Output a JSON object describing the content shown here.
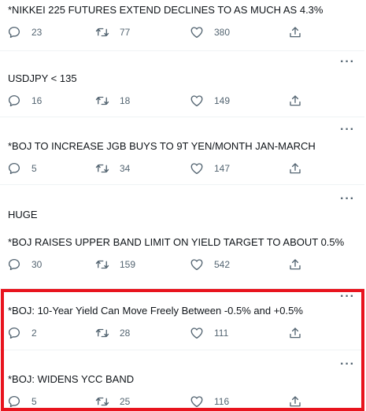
{
  "tweets": [
    {
      "text": "*NIKKEI 225 FUTURES EXTEND DECLINES TO AS MUCH AS 4.3%",
      "replies": "23",
      "retweets": "77",
      "likes": "380",
      "more": "···"
    },
    {
      "text": "USDJPY < 135",
      "replies": "16",
      "retweets": "18",
      "likes": "149",
      "more": "···"
    },
    {
      "text": "*BOJ TO INCREASE JGB BUYS TO 9T YEN/MONTH JAN-MARCH",
      "replies": "5",
      "retweets": "34",
      "likes": "147",
      "more": "···"
    },
    {
      "text": "HUGE",
      "text2": "*BOJ RAISES UPPER BAND LIMIT ON YIELD TARGET TO ABOUT  0.5%",
      "replies": "30",
      "retweets": "159",
      "likes": "542",
      "more": "···"
    },
    {
      "text": "*BOJ: 10-Year Yield Can Move Freely Between -0.5% and +0.5%",
      "replies": "2",
      "retweets": "28",
      "likes": "111",
      "more": "···"
    },
    {
      "text": "*BOJ: WIDENS YCC BAND",
      "replies": "5",
      "retweets": "25",
      "likes": "116",
      "more": "···"
    }
  ],
  "icons": {
    "reply": "reply-bubble-icon",
    "retweet": "retweet-arrows-icon",
    "like": "heart-icon",
    "share": "share-upload-icon",
    "more": "more-dots-icon"
  },
  "colors": {
    "text": "#0f1419",
    "muted": "#536471",
    "highlight_border": "#e8141e",
    "divider": "#eff3f4"
  }
}
